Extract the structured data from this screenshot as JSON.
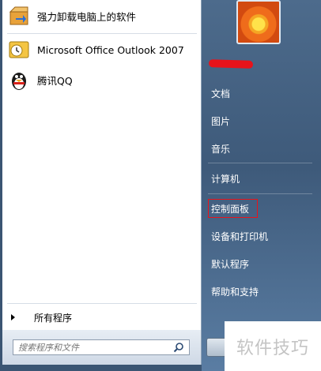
{
  "pinned": [
    {
      "label": "强力卸载电脑上的软件",
      "icon": "uninstaller-box-icon"
    },
    {
      "label": "Microsoft Office Outlook 2007",
      "icon": "outlook-icon"
    },
    {
      "label": "腾讯QQ",
      "icon": "qq-penguin-icon"
    }
  ],
  "all_programs": "所有程序",
  "search": {
    "placeholder": "搜索程序和文件"
  },
  "right_items": [
    {
      "label": "文档"
    },
    {
      "label": "图片"
    },
    {
      "label": "音乐"
    },
    {
      "label": "计算机"
    },
    {
      "label": "控制面板"
    },
    {
      "label": "设备和打印机"
    },
    {
      "label": "默认程序"
    },
    {
      "label": "帮助和支持"
    }
  ],
  "watermark": "软件技巧",
  "colors": {
    "highlight_border": "#e8131b",
    "right_panel": "#4d6b8c"
  }
}
